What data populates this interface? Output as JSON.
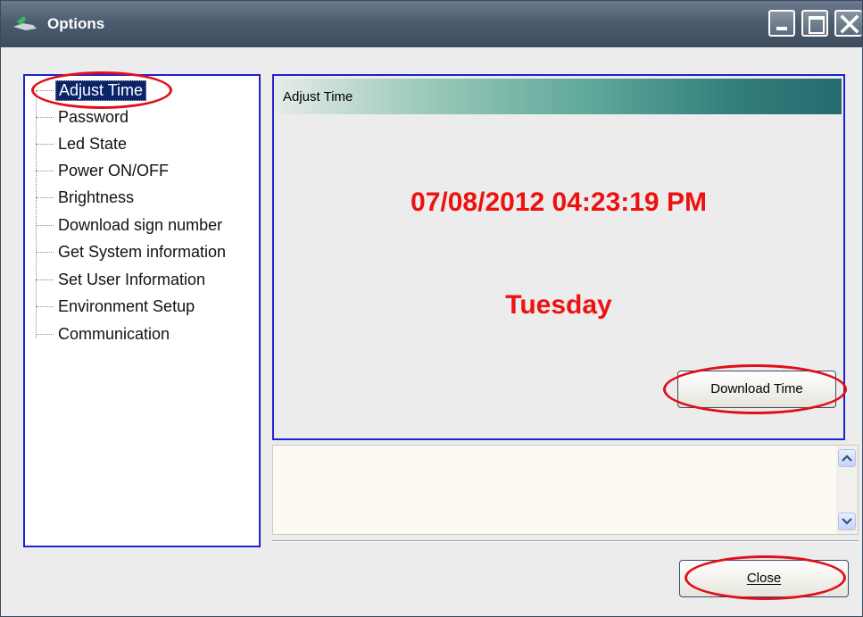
{
  "window": {
    "title": "Options"
  },
  "tree": {
    "items": [
      {
        "label": "Adjust Time",
        "selected": true
      },
      {
        "label": "Password"
      },
      {
        "label": "Led State"
      },
      {
        "label": "Power ON/OFF"
      },
      {
        "label": "Brightness"
      },
      {
        "label": "Download sign number"
      },
      {
        "label": "Get System information"
      },
      {
        "label": "Set User Information"
      },
      {
        "label": "Environment Setup"
      },
      {
        "label": "Communication"
      }
    ]
  },
  "panel": {
    "header": "Adjust Time",
    "datetime": "07/08/2012 04:23:19 PM",
    "weekday": "Tuesday",
    "download_button": "Download Time"
  },
  "textbox": {
    "value": ""
  },
  "footer": {
    "close_button": "Close"
  },
  "colors": {
    "accent_red": "#ee1111",
    "panel_border": "#2020d0",
    "selection": "#0a246a",
    "annotation": "#e0101a"
  }
}
